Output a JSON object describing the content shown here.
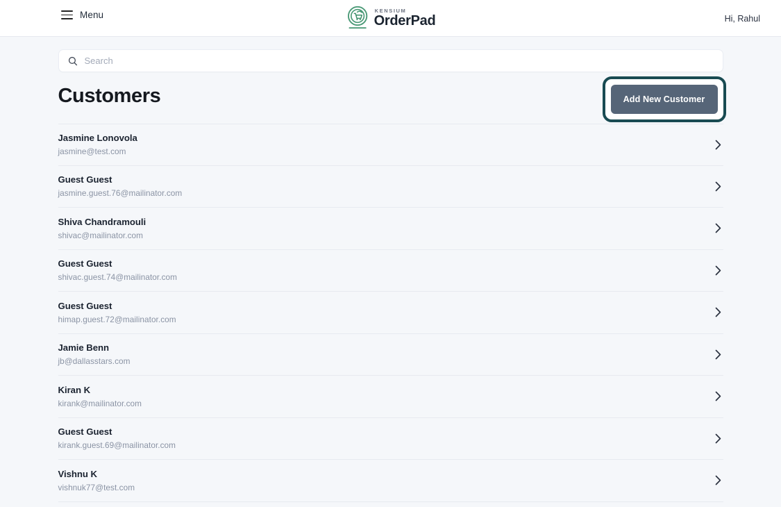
{
  "header": {
    "menu_label": "Menu",
    "menu_icon": "hamburger-icon",
    "brand_kensium": "KENSIUM",
    "brand_name": "OrderPad",
    "brand_icon": "cart-refresh-circle-logo",
    "greeting": "Hi, Rahul"
  },
  "search": {
    "placeholder": "Search",
    "value": "",
    "icon": "search-icon"
  },
  "main": {
    "title": "Customers",
    "add_button_label": "Add New Customer",
    "highlight_color": "#194b52",
    "button_color": "#566578"
  },
  "customers": [
    {
      "name": "Jasmine Lonovola",
      "email": "jasmine@test.com"
    },
    {
      "name": "Guest Guest",
      "email": "jasmine.guest.76@mailinator.com"
    },
    {
      "name": "Shiva Chandramouli",
      "email": "shivac@mailinator.com"
    },
    {
      "name": "Guest Guest",
      "email": "shivac.guest.74@mailinator.com"
    },
    {
      "name": "Guest Guest",
      "email": "himap.guest.72@mailinator.com"
    },
    {
      "name": "Jamie Benn",
      "email": "jb@dallasstars.com"
    },
    {
      "name": "Kiran K",
      "email": "kirank@mailinator.com"
    },
    {
      "name": "Guest Guest",
      "email": "kirank.guest.69@mailinator.com"
    },
    {
      "name": "Vishnu K",
      "email": "vishnuk77@test.com"
    }
  ],
  "icons": {
    "row_chevron": "chevron-right-icon"
  }
}
